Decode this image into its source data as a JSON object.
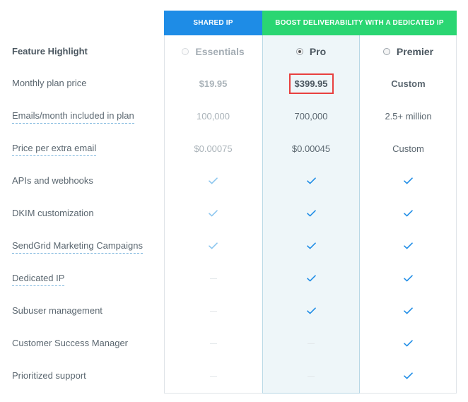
{
  "header": {
    "shared_ip": "SHARED IP",
    "boost": "BOOST DELIVERABILITY WITH A DEDICATED IP"
  },
  "feature_highlight_label": "Feature Highlight",
  "plans": [
    {
      "name": "Essentials",
      "selected": false
    },
    {
      "name": "Pro",
      "selected": true
    },
    {
      "name": "Premier",
      "selected": false
    }
  ],
  "rows": [
    {
      "label": "Monthly plan price",
      "dashed": false,
      "values": [
        "$19.95",
        "$399.95",
        "Custom"
      ]
    },
    {
      "label": "Emails/month included in plan",
      "dashed": true,
      "values": [
        "100,000",
        "700,000",
        "2.5+ million"
      ]
    },
    {
      "label": "Price per extra email",
      "dashed": true,
      "values": [
        "$0.00075",
        "$0.00045",
        "Custom"
      ]
    },
    {
      "label": "APIs and webhooks",
      "dashed": false,
      "values": [
        "check",
        "check",
        "check"
      ]
    },
    {
      "label": "DKIM customization",
      "dashed": false,
      "values": [
        "check",
        "check",
        "check"
      ]
    },
    {
      "label": "SendGrid Marketing Campaigns",
      "dashed": true,
      "values": [
        "check",
        "check",
        "check"
      ]
    },
    {
      "label": "Dedicated IP",
      "dashed": true,
      "values": [
        "dash",
        "check",
        "check"
      ]
    },
    {
      "label": "Subuser management",
      "dashed": false,
      "values": [
        "dash",
        "check",
        "check"
      ]
    },
    {
      "label": "Customer Success Manager",
      "dashed": false,
      "values": [
        "dash",
        "dash",
        "check"
      ]
    },
    {
      "label": "Prioritized support",
      "dashed": false,
      "values": [
        "dash",
        "dash",
        "check"
      ]
    }
  ],
  "colors": {
    "shared_header": "#1e8ce6",
    "boost_header": "#2ad672",
    "check_faded": "#8cc6ef",
    "check_strong": "#1e8ce6",
    "highlight_border": "#e8403f"
  }
}
